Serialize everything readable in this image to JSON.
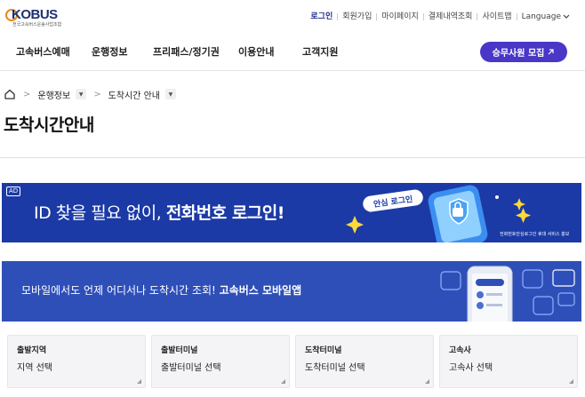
{
  "header": {
    "logo_word": "KOBUS",
    "logo_sub": "전국고속버스운송사업조합",
    "utility": [
      {
        "label": "로그인",
        "name": "login-link"
      },
      {
        "label": "회원가입",
        "name": "signup-link"
      },
      {
        "label": "마이페이지",
        "name": "mypage-link"
      },
      {
        "label": "결제내역조회",
        "name": "payment-history-link"
      },
      {
        "label": "사이트맵",
        "name": "sitemap-link"
      }
    ],
    "language_label": "Language",
    "language_icon": "chevron-down-icon"
  },
  "nav": {
    "items": [
      "고속버스예매",
      "운행정보",
      "프리패스/정기권",
      "이용안내",
      "고객지원"
    ],
    "recruit_label": "승무사원 모집",
    "recruit_icon": "arrow-up-right-icon"
  },
  "breadcrumb": {
    "home_icon": "home-icon",
    "level1": "운행정보",
    "level2": "도착시간 안내"
  },
  "page_title": "도착시간안내",
  "ad_banner": {
    "tag": "AD",
    "text_plain": "ID 찾을 필요 없이, ",
    "text_bold": "전화번호 로그인!",
    "badge": "안심 로그인",
    "small_print": "전화번호안심로그인 휴대 서비스 홍보",
    "background": "#1b3aa6"
  },
  "app_banner": {
    "text_plain": "모바일에서도 언제 어디서나 도착시간 조회! ",
    "text_bold": "고속버스 모바일앱",
    "background": "#2f4fb8"
  },
  "filters": [
    {
      "label": "출발지역",
      "value": "지역 선택"
    },
    {
      "label": "출발터미널",
      "value": "출발터미널 선택"
    },
    {
      "label": "도착터미널",
      "value": "도착터미널 선택"
    },
    {
      "label": "고속사",
      "value": "고속사 선택"
    }
  ],
  "colors": {
    "accent": "#4a37c8",
    "brand": "#1f2f6e"
  }
}
